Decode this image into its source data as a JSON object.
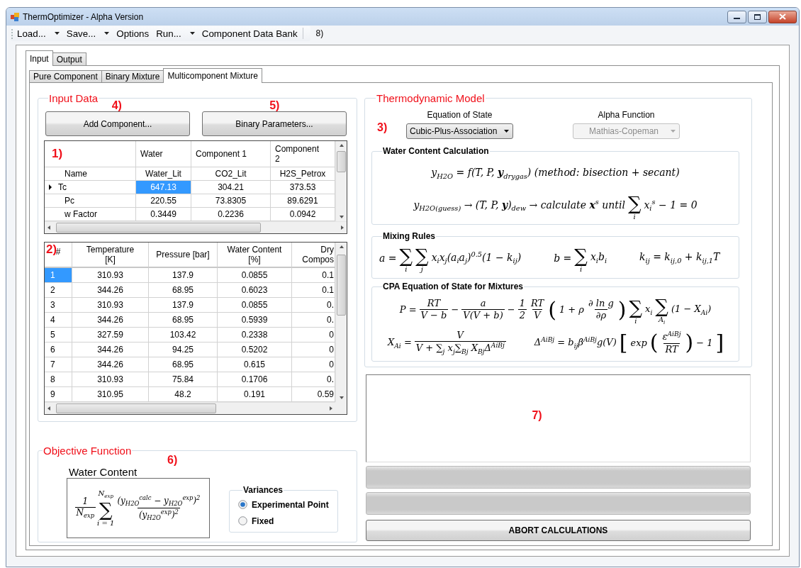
{
  "window": {
    "title": "ThermOptimizer - Alpha Version"
  },
  "toolbar": {
    "items": [
      {
        "label": "Load...",
        "dropdown": true
      },
      {
        "label": "Save...",
        "dropdown": true
      },
      {
        "label": "Options",
        "dropdown": false
      },
      {
        "label": "Run...",
        "dropdown": true
      },
      {
        "label": "Component Data Bank",
        "dropdown": false
      }
    ],
    "marker": "8)"
  },
  "tabs": [
    {
      "label": "Input",
      "selected": true
    },
    {
      "label": "Output",
      "selected": false
    }
  ],
  "subtabs": [
    {
      "label": "Pure Component",
      "selected": false
    },
    {
      "label": "Binary Mixture",
      "selected": false
    },
    {
      "label": "Multicomponent Mixture",
      "selected": true
    }
  ],
  "input_data": {
    "title": "Input Data",
    "buttons": [
      {
        "label": "Add Component...",
        "marker": "4)"
      },
      {
        "label": "Binary Parameters...",
        "marker": "5)"
      }
    ],
    "component_grid": {
      "marker": "1)",
      "columns": [
        "Water",
        "Component 1",
        "Component 2"
      ],
      "rows": [
        {
          "label": "Name",
          "current": false,
          "cells": [
            {
              "text": "Water_Lit",
              "selected": false
            },
            {
              "text": "CO2_Lit",
              "selected": false
            },
            {
              "text": "H2S_Petrox",
              "selected": false
            }
          ]
        },
        {
          "label": "Tc",
          "current": true,
          "cells": [
            {
              "text": "647.13",
              "selected": true
            },
            {
              "text": "304.21",
              "selected": false
            },
            {
              "text": "373.53",
              "selected": false
            }
          ]
        },
        {
          "label": "Pc",
          "current": false,
          "cells": [
            {
              "text": "220.55",
              "selected": false
            },
            {
              "text": "73.8305",
              "selected": false
            },
            {
              "text": "89.6291",
              "selected": false
            }
          ]
        },
        {
          "label": "w Factor",
          "current": false,
          "cells": [
            {
              "text": "0.3449",
              "selected": false
            },
            {
              "text": "0.2236",
              "selected": false
            },
            {
              "text": "0.0942",
              "selected": false
            }
          ]
        }
      ]
    },
    "data_grid": {
      "marker": "2)",
      "columns": [
        "#",
        "Temperature [K]",
        "Pressure [bar]",
        "Water Content [%]",
        "Dry Compos"
      ],
      "rows": [
        {
          "selected": true,
          "cells": [
            "1",
            "310.93",
            "137.9",
            "0.0855",
            "0.1"
          ]
        },
        {
          "selected": false,
          "cells": [
            "2",
            "344.26",
            "68.95",
            "0.6023",
            "0.1"
          ]
        },
        {
          "selected": false,
          "cells": [
            "3",
            "310.93",
            "137.9",
            "0.0855",
            "0."
          ]
        },
        {
          "selected": false,
          "cells": [
            "4",
            "344.26",
            "68.95",
            "0.5939",
            "0."
          ]
        },
        {
          "selected": false,
          "cells": [
            "5",
            "327.59",
            "103.42",
            "0.2338",
            "0"
          ]
        },
        {
          "selected": false,
          "cells": [
            "6",
            "344.26",
            "94.25",
            "0.5202",
            "0"
          ]
        },
        {
          "selected": false,
          "cells": [
            "7",
            "344.26",
            "68.95",
            "0.615",
            "0"
          ]
        },
        {
          "selected": false,
          "cells": [
            "8",
            "310.93",
            "75.84",
            "0.1706",
            "0."
          ]
        },
        {
          "selected": false,
          "cells": [
            "9",
            "310.95",
            "48.2",
            "0.191",
            "0.59"
          ]
        }
      ]
    }
  },
  "objective": {
    "title": "Objective Function",
    "marker": "6)",
    "caption": "Water Content",
    "formula": {
      "parts": [
        {
          "kind": "frac",
          "num": "1",
          "den": "N$_{exp}$"
        },
        {
          "kind": "sum",
          "symbol": "∑",
          "above": "N$_{exp}$",
          "below": "i = 1"
        },
        {
          "kind": "frac",
          "num": "(y$_{H2O}$$^{calc}$ − y$_{H2O}$$^{exp}$)$^{2}$",
          "den": "(y$_{H2O}$$^{exp}$)$^{2}$"
        }
      ]
    },
    "variances": {
      "title": "Variances",
      "options": [
        {
          "label": "Experimental Point",
          "selected": true
        },
        {
          "label": "Fixed",
          "selected": false
        }
      ]
    }
  },
  "thermo": {
    "title": "Thermodynamic Model",
    "marker": "3)",
    "selectors": [
      {
        "label": "Equation of State",
        "value": "Cubic-Plus-Association",
        "disabled": false
      },
      {
        "label": "Alpha Function",
        "value": "Mathias-Copeman",
        "disabled": true
      }
    ],
    "sections": [
      {
        "title": "Water Content Calculation",
        "rows": [
          {
            "formulas": [
              {
                "parts": [
                  {
                    "kind": "text",
                    "text": "y$_{H2O}$ = f(T, P, **y**$_{drygas}$) (method: bisection + secant)"
                  }
                ]
              }
            ]
          },
          {
            "formulas": [
              {
                "parts": [
                  {
                    "kind": "text",
                    "text": "y$_{H2O(guess)}$ → (T, P, **y**)$_{dew}$ → calculate **x**$^{s}$ until"
                  },
                  {
                    "kind": "sum",
                    "symbol": "∑",
                    "below": "i"
                  },
                  {
                    "kind": "text",
                    "text": "x$_{i}$$^{s}$ − 1 = 0"
                  }
                ]
              }
            ]
          }
        ]
      },
      {
        "title": "Mixing Rules",
        "rows": [
          {
            "formulas": [
              {
                "parts": [
                  {
                    "kind": "text",
                    "text": "a ="
                  },
                  {
                    "kind": "sum",
                    "symbol": "∑",
                    "below": "i"
                  },
                  {
                    "kind": "sum",
                    "symbol": "∑",
                    "below": "j"
                  },
                  {
                    "kind": "text",
                    "text": "x$_{i}$x$_{j}$(a$_{i}$a$_{j}$)$^{0.5}$(1 − k$_{ij}$)"
                  }
                ]
              },
              {
                "parts": [
                  {
                    "kind": "text",
                    "text": "b ="
                  },
                  {
                    "kind": "sum",
                    "symbol": "∑",
                    "below": "i"
                  },
                  {
                    "kind": "text",
                    "text": "x$_{i}$b$_{i}$"
                  }
                ]
              },
              {
                "parts": [
                  {
                    "kind": "text",
                    "text": "k$_{ij}$ = k$_{ij,0}$ + k$_{ij,1}$T"
                  }
                ]
              }
            ]
          }
        ]
      },
      {
        "title": "CPA Equation of State for Mixtures",
        "rows": [
          {
            "formulas": [
              {
                "parts": [
                  {
                    "kind": "text",
                    "text": "P ="
                  },
                  {
                    "kind": "frac",
                    "num": "RT",
                    "den": "V − b"
                  },
                  {
                    "kind": "text",
                    "text": "−"
                  },
                  {
                    "kind": "frac",
                    "num": "a",
                    "den": "V(V + b)"
                  },
                  {
                    "kind": "text",
                    "text": "−"
                  },
                  {
                    "kind": "frac",
                    "num": "1",
                    "den": "2"
                  },
                  {
                    "kind": "frac",
                    "num": "RT",
                    "den": "V"
                  },
                  {
                    "kind": "big",
                    "text": "("
                  },
                  {
                    "kind": "text",
                    "text": "1 + ρ"
                  },
                  {
                    "kind": "frac",
                    "num": "∂ ln g",
                    "den": "∂ρ"
                  },
                  {
                    "kind": "big",
                    "text": ")"
                  },
                  {
                    "kind": "sum",
                    "symbol": "∑",
                    "below": "i"
                  },
                  {
                    "kind": "text",
                    "text": "x$_{i}$"
                  },
                  {
                    "kind": "sum",
                    "symbol": "∑",
                    "below": "A$_{i}$"
                  },
                  {
                    "kind": "text",
                    "text": "(1 − X$_{Ai}$)"
                  }
                ]
              }
            ]
          },
          {
            "formulas": [
              {
                "parts": [
                  {
                    "kind": "text",
                    "text": "X$_{Ai}$ ="
                  },
                  {
                    "kind": "frac",
                    "num": "V",
                    "den": "V + ∑$_{j}$ x$_{j}$∑$_{Bj}$ X$_{Bj}$Δ$^{AiBj}$"
                  }
                ]
              },
              {
                "parts": [
                  {
                    "kind": "text",
                    "text": "Δ$^{AiBj}$ = b$_{ij}$β$^{AiBj}$g(V)"
                  },
                  {
                    "kind": "big",
                    "text": "["
                  },
                  {
                    "kind": "text",
                    "text": "exp"
                  },
                  {
                    "kind": "big",
                    "text": "("
                  },
                  {
                    "kind": "frac",
                    "num": "ε$^{AiBj}$",
                    "den": "RT"
                  },
                  {
                    "kind": "big",
                    "text": ")"
                  },
                  {
                    "kind": "text",
                    "text": "− 1"
                  },
                  {
                    "kind": "big",
                    "text": "]"
                  }
                ]
              }
            ]
          }
        ]
      }
    ]
  },
  "results": {
    "marker": "7)"
  },
  "progress_bars": [
    {
      "level": 0
    },
    {
      "level": 0
    }
  ],
  "abort_button": "ABORT CALCULATIONS"
}
